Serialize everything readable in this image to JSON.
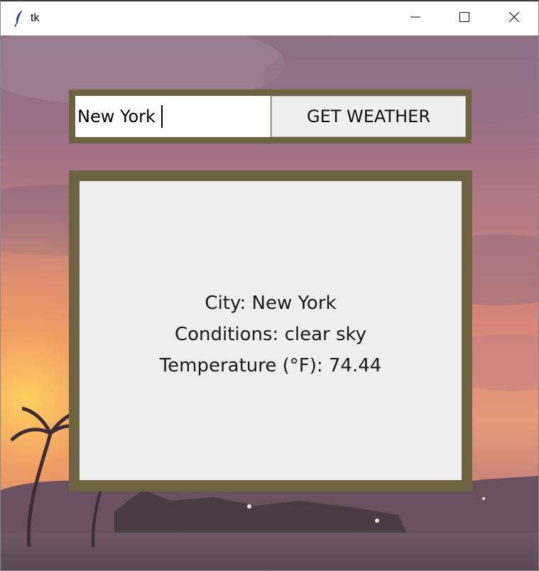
{
  "window": {
    "title": "tk",
    "icons": {
      "app": "feather-icon",
      "minimize": "minimize-icon",
      "maximize": "maximize-icon",
      "close": "close-icon"
    }
  },
  "search": {
    "value": "New York",
    "button_label": "GET WEATHER"
  },
  "result": {
    "city_line": "City: New York",
    "conditions_line": "Conditions: clear sky",
    "temperature_line": "Temperature (°F): 74.44"
  },
  "colors": {
    "frame": "#6d6341",
    "panel": "#eeeeee",
    "button": "#efefef"
  }
}
